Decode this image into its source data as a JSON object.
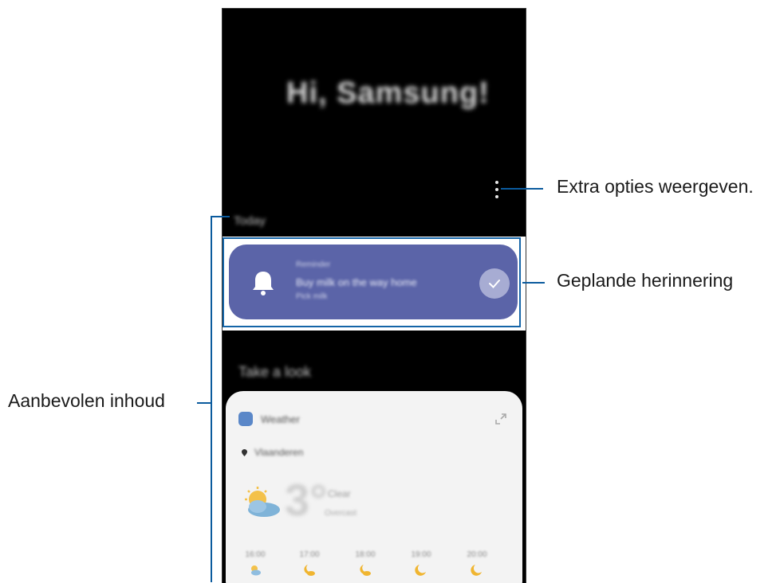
{
  "phone": {
    "greeting": "Hi, Samsung!",
    "section_today": "Today",
    "section_look": "Take a look",
    "reminder": {
      "label": "Reminder",
      "text": "Buy milk on the way home",
      "sub": "Pick milk"
    },
    "weather": {
      "app_name": "Weather",
      "location": "Vlaanderen",
      "temperature": "3°",
      "description": "Clear",
      "detail": "Overcast",
      "hours": [
        {
          "time": "16:00",
          "icon": "sun-cloud-icon"
        },
        {
          "time": "17:00",
          "icon": "moon-cloud-icon"
        },
        {
          "time": "18:00",
          "icon": "moon-cloud-icon"
        },
        {
          "time": "19:00",
          "icon": "moon-icon"
        },
        {
          "time": "20:00",
          "icon": "moon-icon"
        }
      ]
    }
  },
  "callouts": {
    "more_options": "Extra opties weergeven.",
    "scheduled_reminder": "Geplande herinnering",
    "recommended_content": "Aanbevolen inhoud"
  },
  "colors": {
    "reminder_card": "#5b64a8",
    "callout_line": "#0b5b9e",
    "highlight_border": "#1565a8"
  }
}
